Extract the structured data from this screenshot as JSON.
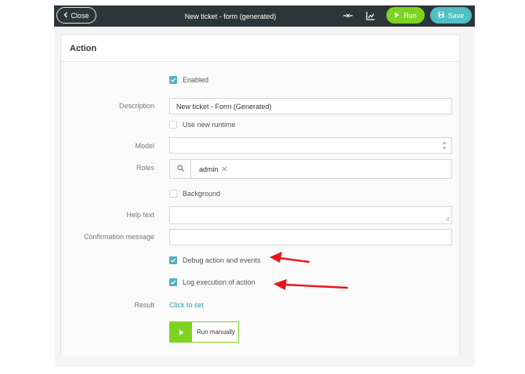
{
  "topbar": {
    "close_label": "Close",
    "title": "New ticket - form (generated)",
    "run_label": "Run",
    "save_label": "Save"
  },
  "card": {
    "title": "Action"
  },
  "form": {
    "enabled_label": "Enabled",
    "enabled_checked": true,
    "description_label": "Description",
    "description_value": "New ticket - Form (Generated)",
    "new_runtime_label": "Use new runtime",
    "new_runtime_checked": false,
    "model_label": "Model",
    "model_value": "",
    "roles_label": "Roles",
    "roles": [
      "admin"
    ],
    "background_label": "Background",
    "background_checked": false,
    "help_text_label": "Help text",
    "help_text_value": "",
    "confirmation_label": "Confirmation message",
    "confirmation_value": "",
    "debug_label": "Debug action and events",
    "debug_checked": true,
    "log_label": "Log execution of action",
    "log_checked": true,
    "result_label": "Result",
    "result_link": "Click to set",
    "run_manually_label": "Run manually"
  },
  "colors": {
    "topbar": "#2c3539",
    "run": "#7ed321",
    "save": "#4fc0c4",
    "checkbox": "#4fb0c0",
    "link": "#2a9fb0",
    "annotation_arrow": "#e8141b"
  }
}
